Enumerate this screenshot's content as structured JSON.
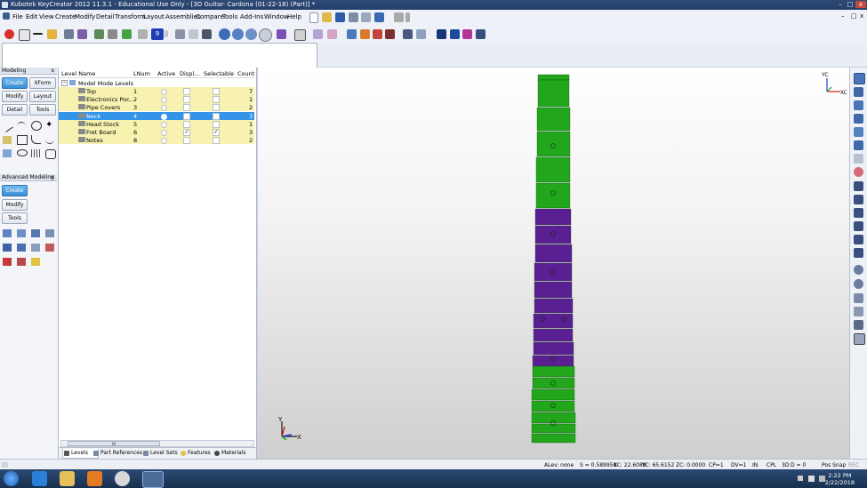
{
  "window": {
    "title": "Kubotek KeyCreator 2012 11.3.1 - Educational Use Only - [3D Guitar- Cardona (01-22-18) (Part)] *",
    "minimize": "–",
    "restore": "□",
    "close": "x"
  },
  "menu": [
    "File",
    "Edit",
    "View",
    "Create",
    "Modify",
    "Detail",
    "Transform",
    "Layout",
    "Assemblies",
    "Compare",
    "Tools",
    "Add-Ins",
    "Window",
    "Help"
  ],
  "toolbar": {
    "level_number": "9"
  },
  "modeling": {
    "title": "Modeling",
    "close": "x",
    "buttons": [
      "Create",
      "XForm",
      "Modify",
      "Layout",
      "Detail",
      "Tools"
    ]
  },
  "advanced": {
    "title": "Advanced Modeling",
    "close": "x",
    "buttons": [
      "Create",
      "Modify",
      "Tools"
    ]
  },
  "levels": {
    "headers": {
      "name": "Level Name",
      "lnum": "LNum",
      "active": "Active",
      "display": "Displ...",
      "selectable": "Selectable",
      "count": "Count"
    },
    "root": "Model Mode Levels",
    "rows": [
      {
        "name": "Top",
        "lnum": "1",
        "count": "7",
        "display": false,
        "selectable": false
      },
      {
        "name": "Electronics Poc...",
        "lnum": "2",
        "count": "1",
        "display": false,
        "selectable": false
      },
      {
        "name": "Pipe Covers",
        "lnum": "3",
        "count": "2",
        "display": false,
        "selectable": false
      },
      {
        "name": "Neck",
        "lnum": "4",
        "count": "3",
        "display": true,
        "selectable": true,
        "selected": true
      },
      {
        "name": "Head Stock",
        "lnum": "5",
        "count": "1",
        "display": false,
        "selectable": false
      },
      {
        "name": "Fret Board",
        "lnum": "6",
        "count": "3",
        "display": true,
        "selectable": true
      },
      {
        "name": "Notes",
        "lnum": "8",
        "count": "2",
        "display": false,
        "selectable": false
      }
    ],
    "check_mark": "✓",
    "scroll_grip": "III"
  },
  "tabs": [
    "Levels",
    "Part References",
    "Level Sets",
    "Features",
    "Materials"
  ],
  "triad": {
    "y": "Y",
    "x": "X",
    "yc": "YC",
    "xc": "XC"
  },
  "status": {
    "alev": "ALev: none",
    "s": "S = 0.589958",
    "xc": "XC: 22.6088",
    "yc": "YC: 65.6152",
    "zc": "ZC: 0.0000",
    "cp": "CP=1",
    "dv": "DV=1",
    "in": "IN",
    "cpl": "CPL",
    "mode": "3D",
    "d": "D = 0",
    "possnap": "Pos Snap",
    "rec": "REC"
  },
  "taskbar": {
    "time": "2:22 PM",
    "date": "2/22/2018"
  },
  "colors": {
    "green": "#22a61c",
    "purple": "#5a1f93",
    "selected": "#3394e8",
    "rowbg": "#f7f2b0"
  }
}
